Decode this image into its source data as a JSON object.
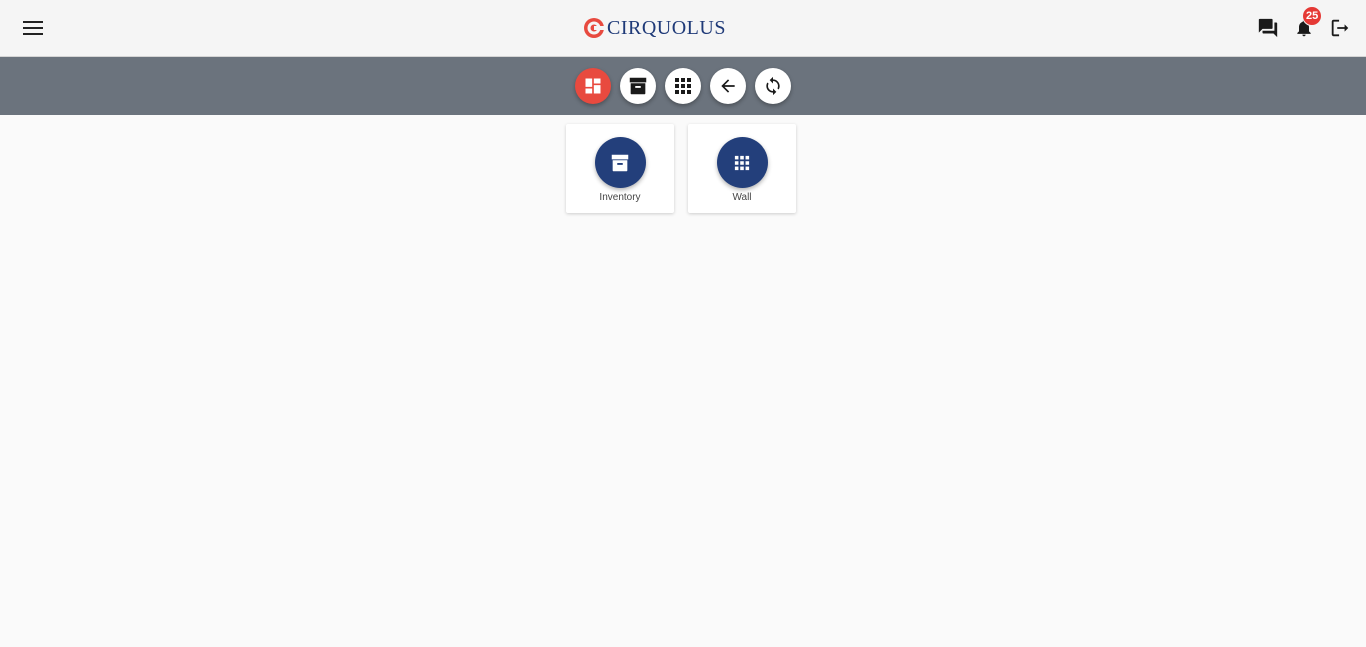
{
  "header": {
    "menu_icon": "menu-icon",
    "logo_text": "CIRQUOLUS",
    "logo_icon": "cirquolus-logo-mark",
    "icons": {
      "chat": "chat-icon",
      "notifications": "bell-icon",
      "logout": "logout-icon"
    },
    "notification_count": "25"
  },
  "toolbar": {
    "buttons": [
      {
        "name": "dashboard",
        "icon": "dashboard-icon",
        "active": true
      },
      {
        "name": "inventory",
        "icon": "archive-icon",
        "active": false
      },
      {
        "name": "apps",
        "icon": "apps-grid-icon",
        "active": false
      },
      {
        "name": "back",
        "icon": "arrow-left-icon",
        "active": false
      },
      {
        "name": "refresh",
        "icon": "refresh-icon",
        "active": false
      }
    ]
  },
  "cards": [
    {
      "label": "Inventory",
      "icon": "archive-icon"
    },
    {
      "label": "Wall",
      "icon": "apps-grid-icon"
    }
  ],
  "colors": {
    "brand": "#1f3a78",
    "accent": "#e84a3f",
    "toolbar_bg": "#6b737d",
    "card_circle": "#233f7b",
    "badge": "#e53935"
  }
}
